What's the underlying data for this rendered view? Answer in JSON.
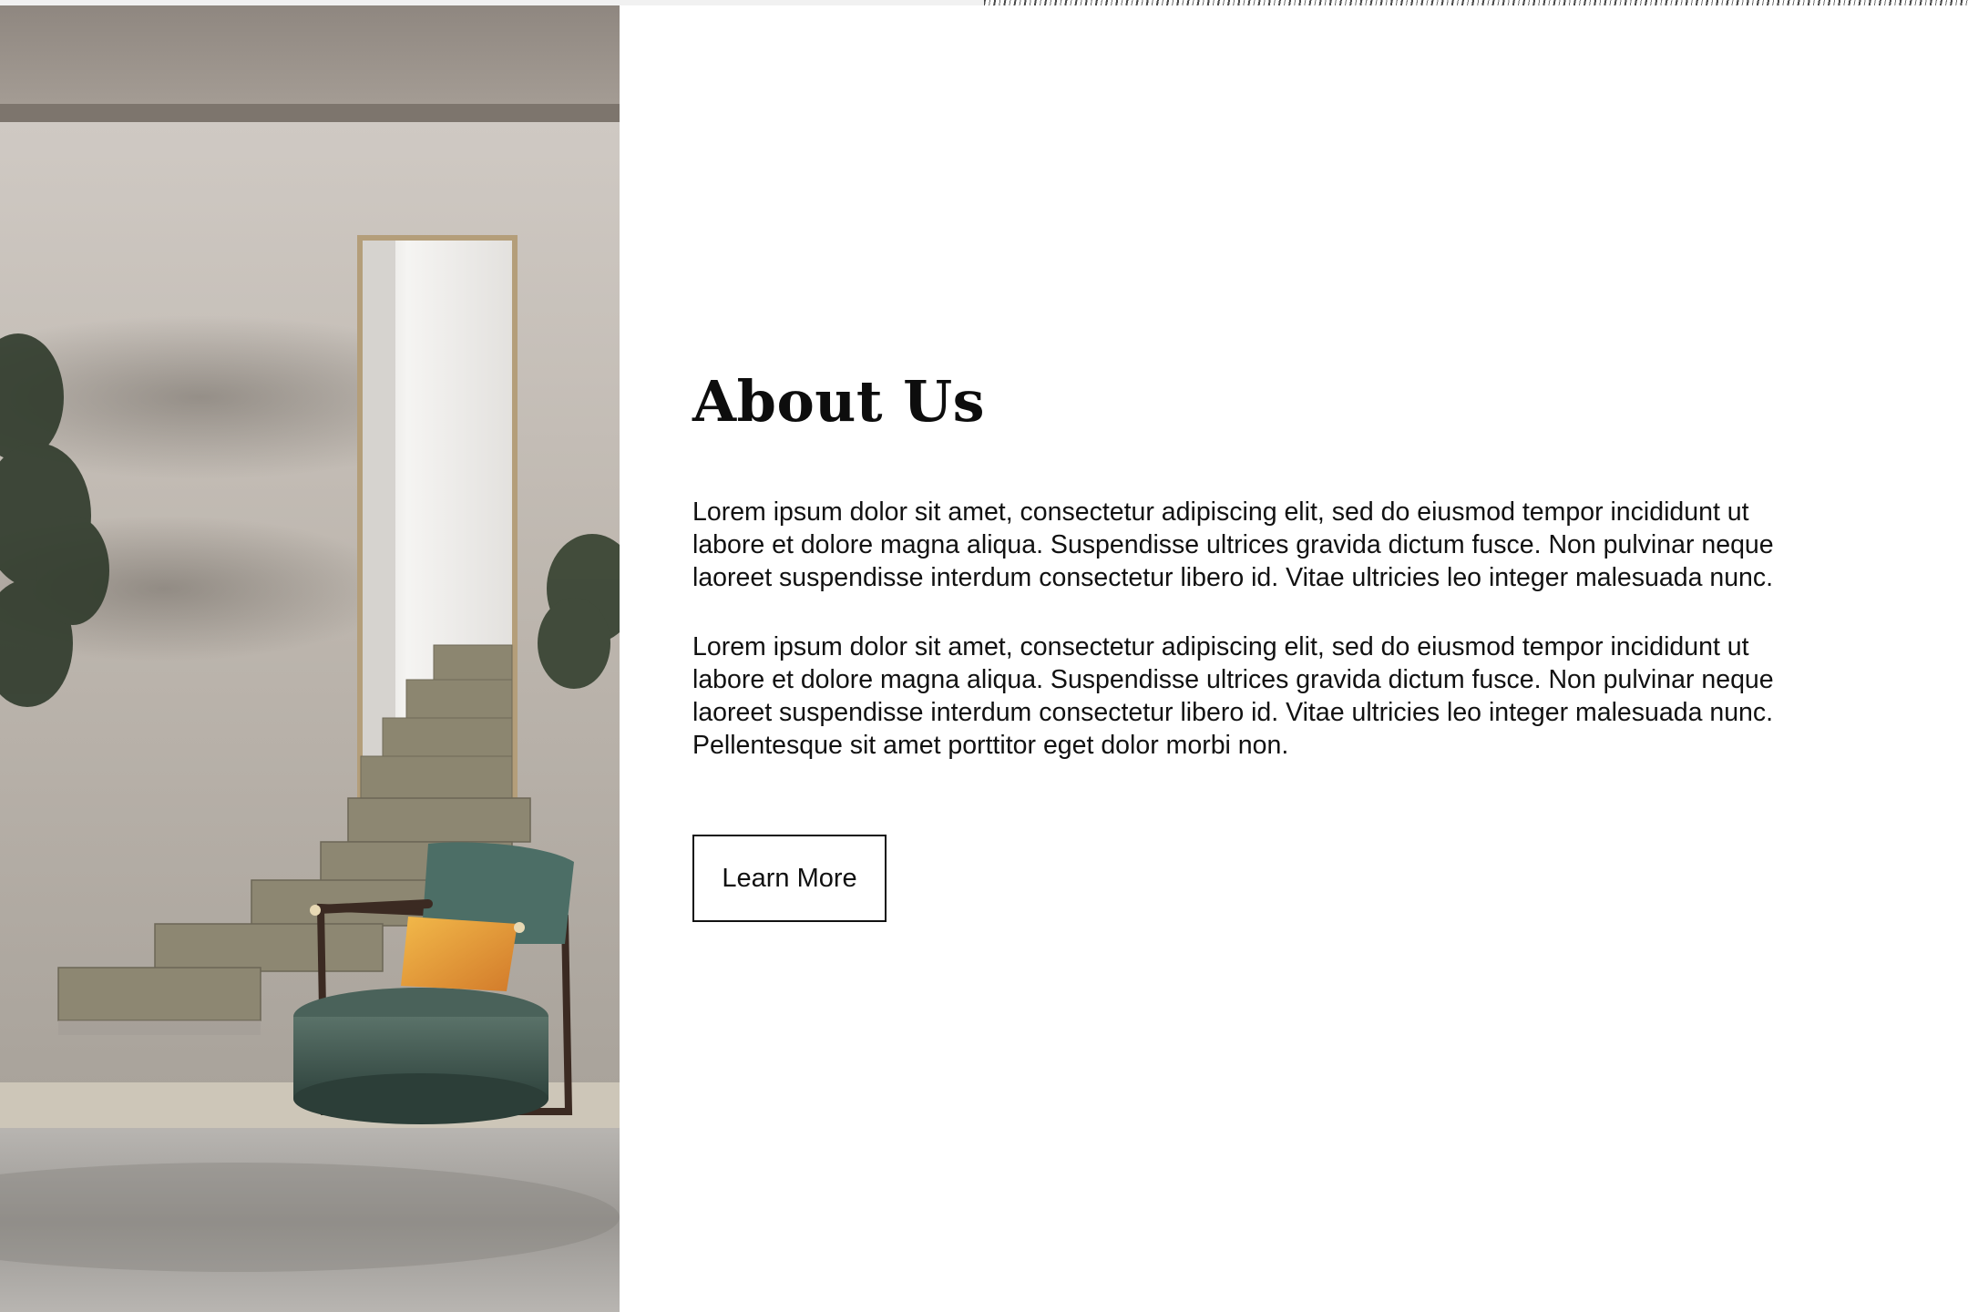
{
  "hero": {
    "image_alt": "Interior with floating stairs, tall doorway and green armchair"
  },
  "about": {
    "title": "About Us",
    "paragraph_1": "Lorem ipsum dolor sit amet, consectetur adipiscing elit, sed do eiusmod tempor incididunt ut labore et dolore magna aliqua. Suspendisse ultrices gravida dictum fusce. Non pulvinar neque laoreet suspendisse interdum consectetur libero id. Vitae ultricies leo integer malesuada nunc.",
    "paragraph_2": "Lorem ipsum dolor sit amet, consectetur adipiscing elit, sed do eiusmod tempor incididunt ut labore et dolore magna aliqua. Suspendisse ultrices gravida dictum fusce. Non pulvinar neque laoreet suspendisse interdum consectetur libero id. Vitae ultricies leo integer malesuada nunc. Pellentesque sit amet porttitor eget dolor morbi non.",
    "button_label": "Learn More"
  },
  "colors": {
    "text": "#111111",
    "background": "#ffffff",
    "armchair": "#3f5a52",
    "pillow": "#e8a43a"
  }
}
